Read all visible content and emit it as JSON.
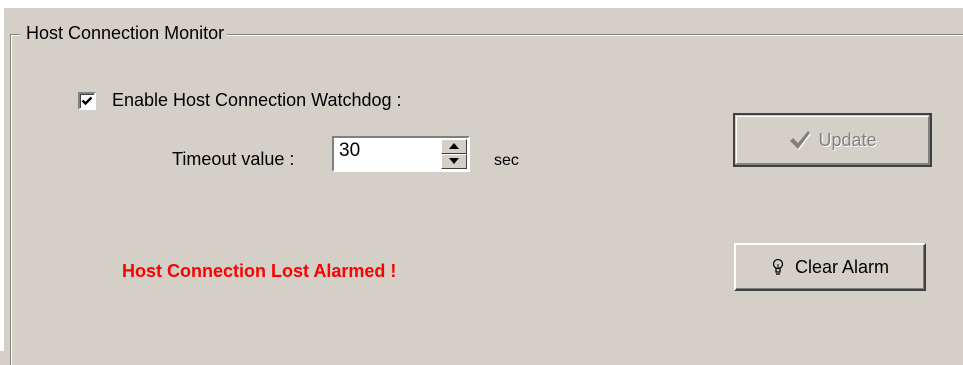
{
  "group": {
    "title": "Host Connection Monitor"
  },
  "watchdog": {
    "label": "Enable Host Connection Watchdog :",
    "checked": true
  },
  "timeout": {
    "label": "Timeout value :",
    "value": "30",
    "unit": "sec"
  },
  "status": {
    "message": "Host Connection Lost Alarmed !",
    "color": "#ff0000"
  },
  "buttons": {
    "update": {
      "label": "Update",
      "icon": "checkmark-icon",
      "enabled": false
    },
    "clear_alarm": {
      "label": "Clear Alarm",
      "icon": "lightbulb-icon"
    }
  }
}
